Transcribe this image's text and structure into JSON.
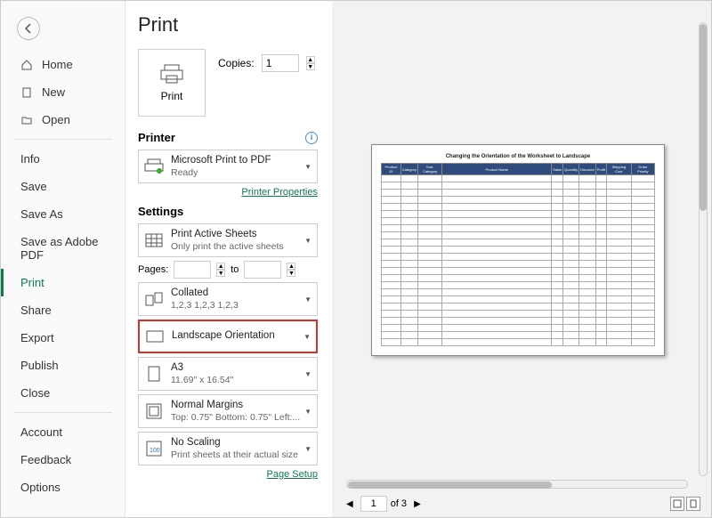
{
  "sidebar": {
    "items": [
      {
        "label": "Home"
      },
      {
        "label": "New"
      },
      {
        "label": "Open"
      },
      {
        "label": "Info"
      },
      {
        "label": "Save"
      },
      {
        "label": "Save As"
      },
      {
        "label": "Save as Adobe PDF"
      },
      {
        "label": "Print"
      },
      {
        "label": "Share"
      },
      {
        "label": "Export"
      },
      {
        "label": "Publish"
      },
      {
        "label": "Close"
      },
      {
        "label": "Account"
      },
      {
        "label": "Feedback"
      },
      {
        "label": "Options"
      }
    ]
  },
  "page": {
    "title": "Print",
    "print_button": "Print",
    "copies_label": "Copies:",
    "copies_value": "1"
  },
  "printer": {
    "section": "Printer",
    "name": "Microsoft Print to PDF",
    "status": "Ready",
    "properties_link": "Printer Properties"
  },
  "settings": {
    "section": "Settings",
    "active_sheets": {
      "title": "Print Active Sheets",
      "sub": "Only print the active sheets"
    },
    "pages_label": "Pages:",
    "pages_to": "to",
    "collated": {
      "title": "Collated",
      "sub": "1,2,3    1,2,3    1,2,3"
    },
    "orientation": {
      "title": "Landscape Orientation"
    },
    "paper": {
      "title": "A3",
      "sub": "11.69\" x 16.54\""
    },
    "margins": {
      "title": "Normal Margins",
      "sub": "Top: 0.75\" Bottom: 0.75\" Left:..."
    },
    "scaling": {
      "title": "No Scaling",
      "sub": "Print sheets at their actual size"
    },
    "page_setup_link": "Page Setup"
  },
  "preview": {
    "doc_title": "Changing the Orientation of the Worksheet to Landscape",
    "headers": [
      "Product ID",
      "Category",
      "Sub-Category",
      "Product Name",
      "Sales",
      "Quantity",
      "Discount",
      "Profit",
      "Shipping Cost",
      "Order Priority"
    ],
    "page_current": "1",
    "page_of": "of 3"
  }
}
